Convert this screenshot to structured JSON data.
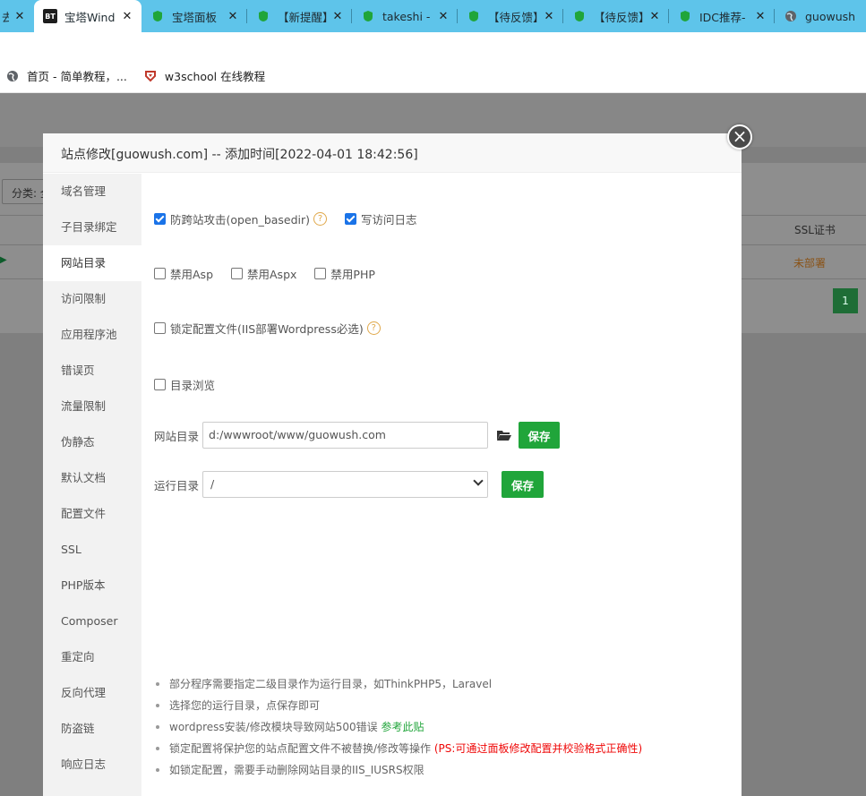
{
  "browser": {
    "tabs": [
      {
        "title": "去]",
        "favicon": "globe-icon"
      },
      {
        "title": "宝塔Wind",
        "favicon": "bt-icon",
        "active": true
      },
      {
        "title": "宝塔面板",
        "favicon": "bt-shield-icon"
      },
      {
        "title": "【新提醒】",
        "favicon": "bt-shield-icon"
      },
      {
        "title": "takeshi -",
        "favicon": "bt-shield-icon"
      },
      {
        "title": "【待反馈】",
        "favicon": "bt-shield-icon"
      },
      {
        "title": "【待反馈】",
        "favicon": "bt-shield-icon"
      },
      {
        "title": "IDC推荐-",
        "favicon": "bt-shield-icon"
      },
      {
        "title": "guowush",
        "favicon": "globe-icon"
      }
    ],
    "bookmarks": [
      {
        "label": "首页 - 简单教程，...",
        "icon": "globe-icon"
      },
      {
        "label": "w3school 在线教程",
        "icon": "w3school-icon"
      }
    ],
    "bt_badge": "BT"
  },
  "background": {
    "category_label": "分类: 全",
    "ssl_header": "SSL证书",
    "ssl_status": "未部署",
    "page_number": "1"
  },
  "modal": {
    "title": "站点修改[guowush.com] -- 添加时间[2022-04-01 18:42:56]",
    "close_symbol": "×",
    "sidebar": [
      "域名管理",
      "子目录绑定",
      "网站目录",
      "访问限制",
      "应用程序池",
      "错误页",
      "流量限制",
      "伪静态",
      "默认文档",
      "配置文件",
      "SSL",
      "PHP版本",
      "Composer",
      "重定向",
      "反向代理",
      "防盗链",
      "响应日志"
    ],
    "active_item": "网站目录",
    "options": {
      "anti_cross": {
        "label": "防跨站攻击(open_basedir)",
        "checked": true
      },
      "access_log": {
        "label": "写访问日志",
        "checked": true
      },
      "disable_asp": {
        "label": "禁用Asp",
        "checked": false
      },
      "disable_aspx": {
        "label": "禁用Aspx",
        "checked": false
      },
      "disable_php": {
        "label": "禁用PHP",
        "checked": false
      },
      "lock_config": {
        "label": "锁定配置文件(IIS部署Wordpress必选)",
        "checked": false
      },
      "dir_browse": {
        "label": "目录浏览",
        "checked": false
      }
    },
    "help_symbol": "?",
    "site_dir": {
      "label": "网站目录",
      "value": "d:/wwwroot/www/guowush.com",
      "save": "保存"
    },
    "run_dir": {
      "label": "运行目录",
      "value": "/",
      "save": "保存"
    },
    "tips": {
      "t1": "部分程序需要指定二级目录作为运行目录，如ThinkPHP5，Laravel",
      "t2": "选择您的运行目录，点保存即可",
      "t3": "wordpress安装/修改模块导致网站500错误",
      "t3_link": "参考此贴",
      "t4": "锁定配置将保护您的站点配置文件不被替换/修改等操作",
      "t4_red": "(PS:可通过面板修改配置并校验格式正确性)",
      "t5": "如锁定配置，需要手动删除网站目录的IIS_IUSRS权限"
    }
  },
  "colors": {
    "accent": "#20a53a",
    "tab_bar": "#5ec4ea",
    "checkbox": "#1a73e8",
    "warning": "#ef0808"
  }
}
